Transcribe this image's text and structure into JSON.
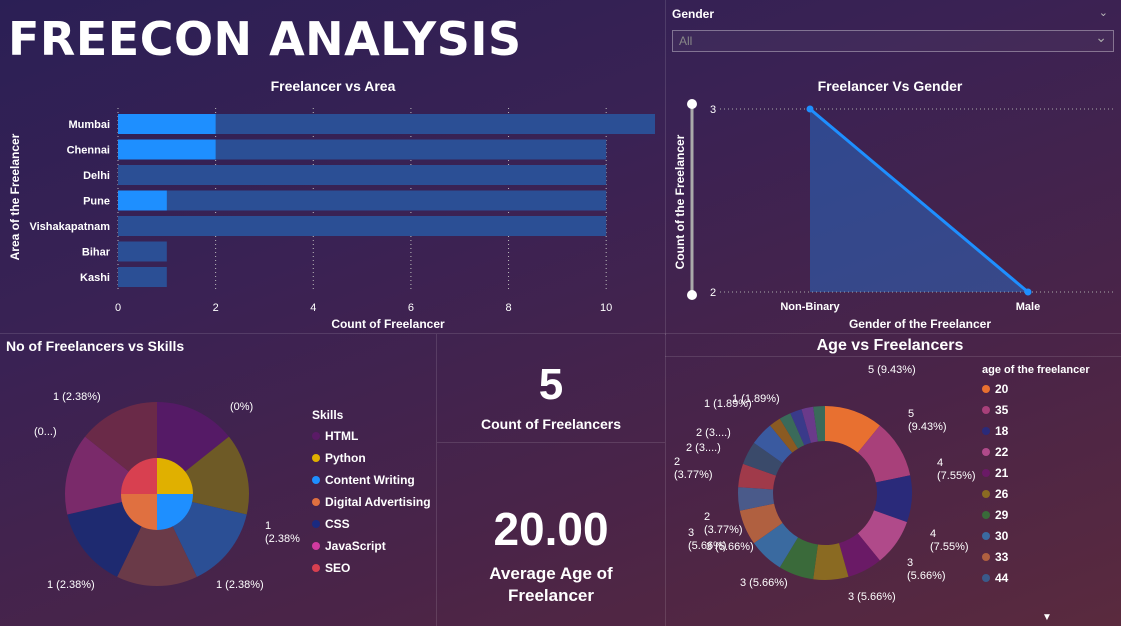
{
  "page_title": "FREECON ANALYSIS",
  "slicer": {
    "label": "Gender",
    "value": "All"
  },
  "area_chart": {
    "title": "Freelancer vs Area",
    "ylabel": "Area of the Freelancer",
    "xlabel": "Count of Freelancer",
    "ticks": [
      "0",
      "2",
      "4",
      "6",
      "8",
      "10"
    ]
  },
  "gender_chart": {
    "title": "Freelancer Vs Gender",
    "ylabel": "Count of the Freelancer",
    "xlabel": "Gender of the Freelancer",
    "y_top": "3",
    "y_bottom": "2"
  },
  "skills_chart": {
    "title": "No of Freelancers vs Skills",
    "legend_title": "Skills"
  },
  "kpi_count": {
    "value": "5",
    "label": "Count of Freelancers"
  },
  "kpi_age": {
    "value": "20.00",
    "label_line1": "Average Age of",
    "label_line2": "Freelancer"
  },
  "age_chart": {
    "title": "Age vs Freelancers",
    "legend_title": "age of the freelancer"
  },
  "chart_data": [
    {
      "type": "bar",
      "title": "Freelancer vs Area",
      "xlabel": "Count of Freelancer",
      "ylabel": "Area of the Freelancer",
      "categories": [
        "Mumbai",
        "Chennai",
        "Delhi",
        "Pune",
        "Vishakapatnam",
        "Bihar",
        "Kashi"
      ],
      "series": [
        {
          "values": [
            11,
            10,
            10,
            10,
            10,
            1,
            1
          ]
        },
        {
          "values": [
            2,
            2,
            0,
            1,
            0,
            0,
            0
          ]
        }
      ],
      "xlim": [
        0,
        11
      ],
      "colors": {
        "total": "#2b4f95",
        "highlight": "#1e8fff"
      }
    },
    {
      "type": "area",
      "title": "Freelancer Vs Gender",
      "xlabel": "Gender of the Freelancer",
      "ylabel": "Count of the Freelancer",
      "categories": [
        "Non-Binary",
        "Male"
      ],
      "values": [
        3,
        2
      ],
      "ylim": [
        2,
        3
      ],
      "color": "#1e8fff"
    },
    {
      "type": "pie",
      "title": "No of Freelancers vs Skills",
      "legend": [
        "HTML",
        "Python",
        "Content Writing",
        "Digital Advertising",
        "CSS",
        "JavaScript",
        "SEO"
      ],
      "colors": [
        "#5a1a66",
        "#e0b000",
        "#1e8fff",
        "#e07040",
        "#1a2a80",
        "#d03aa0",
        "#d84050"
      ],
      "labels": [
        "(0%)",
        "1\n(2.38%)",
        "1 (2.38%)",
        "1 (2.38%)",
        "(0...)",
        "1 (2.38%)"
      ],
      "outer_colors": [
        "#551a66",
        "#6e5a26",
        "#2b4f95",
        "#6a3a48",
        "#1e2a70",
        "#7a2a6a",
        "#6a2a48"
      ],
      "outer_values": [
        8,
        8,
        8,
        8,
        8,
        8,
        8
      ],
      "inner_colors": [
        "#e0b000",
        "#1e8fff",
        "#e07040",
        "#d84050"
      ],
      "inner_values": [
        1,
        1,
        1,
        1
      ]
    },
    {
      "type": "pie",
      "title": "Age vs Freelancers",
      "legend": [
        "20",
        "35",
        "18",
        "22",
        "21",
        "26",
        "29",
        "30",
        "33",
        "44"
      ],
      "legend_colors": [
        "#e87030",
        "#a8407a",
        "#2a2a7a",
        "#b04a8a",
        "#6a1a66",
        "#8a6a22",
        "#3a6a3a",
        "#3a6aa0",
        "#b06040",
        "#3a5a8a"
      ],
      "values": [
        5,
        5,
        4,
        4,
        3,
        3,
        3,
        3,
        3,
        2,
        2,
        2,
        2,
        1,
        1,
        1,
        1,
        1
      ],
      "segment_colors": [
        "#e87030",
        "#a8407a",
        "#2a2a7a",
        "#b04a8a",
        "#6a1a66",
        "#8a6a22",
        "#3a6a3a",
        "#3a6aa0",
        "#b06040",
        "#4a5a8a",
        "#a03a4a",
        "#3a4a6a",
        "#3a5aa0",
        "#8a5a22",
        "#3a6a5a",
        "#3a3a8a",
        "#6a3a8a",
        "#3a6a5a"
      ],
      "labels": [
        "5 (9.43%)",
        "5\n(9.43%)",
        "4\n(7.55%)",
        "4\n(7.55%)",
        "3\n(5.66%)",
        "3 (5.66%)",
        "3 (5.66%)",
        "3 (5.66%)",
        "3\n(5.66%)",
        "2\n(3.77%)",
        "2\n(3.77%)",
        "2 (3....)",
        "2 (3....)",
        "1 (1.89%)",
        "1 (1.89%)"
      ]
    }
  ]
}
